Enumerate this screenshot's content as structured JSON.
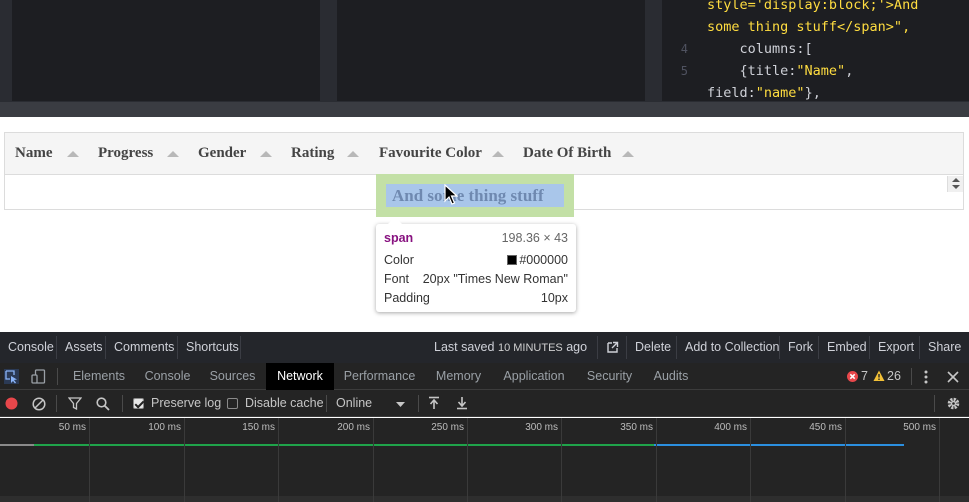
{
  "editor": {
    "lines": [
      {
        "num": "",
        "parts": [
          {
            "t": "style='display:block;'>And",
            "c": "str"
          }
        ]
      },
      {
        "num": "",
        "parts": [
          {
            "t": "some thing stuff</span>\",",
            "c": "str"
          }
        ]
      },
      {
        "num": "4",
        "parts": [
          {
            "t": "    columns:[",
            "c": "key"
          }
        ]
      },
      {
        "num": "5",
        "parts": [
          {
            "t": "    {title:",
            "c": "key"
          },
          {
            "t": "\"Name\"",
            "c": "str"
          },
          {
            "t": ",",
            "c": "key"
          }
        ]
      },
      {
        "num": "",
        "parts": [
          {
            "t": "field:",
            "c": "key"
          },
          {
            "t": "\"name\"",
            "c": "str"
          },
          {
            "t": "},",
            "c": "key"
          }
        ]
      }
    ]
  },
  "table": {
    "columns": [
      "Name",
      "Progress",
      "Gender",
      "Rating",
      "Favourite Color",
      "Date Of Birth"
    ],
    "highlight_text": "And some thing stuff"
  },
  "tooltip": {
    "tag": "span",
    "size": "198.36 × 43",
    "color_label": "Color",
    "color_value": "#000000",
    "font_label": "Font",
    "font_value": "20px \"Times New Roman\"",
    "padding_label": "Padding",
    "padding_value": "10px"
  },
  "codepen_bar": {
    "console": "Console",
    "assets": "Assets",
    "comments": "Comments",
    "shortcuts": "Shortcuts",
    "last_saved_prefix": "Last saved",
    "last_saved_time": "10 MINUTES",
    "last_saved_suffix": "ago",
    "delete": "Delete",
    "add_to_collection": "Add to Collection",
    "fork": "Fork",
    "embed": "Embed",
    "export": "Export",
    "share": "Share"
  },
  "devtools": {
    "tabs": [
      "Elements",
      "Console",
      "Sources",
      "Network",
      "Performance",
      "Memory",
      "Application",
      "Security",
      "Audits"
    ],
    "active_tab": "Network",
    "errors": "7",
    "warnings": "26",
    "preserve_log": "Preserve log",
    "preserve_log_checked": true,
    "disable_cache": "Disable cache",
    "disable_cache_checked": false,
    "throttle": "Online",
    "timeline_labels": [
      "50 ms",
      "100 ms",
      "150 ms",
      "200 ms",
      "250 ms",
      "300 ms",
      "350 ms",
      "400 ms",
      "450 ms",
      "500 ms"
    ],
    "colors": {
      "green": "#1fa34a",
      "blue": "#2b8fe0",
      "error": "#e8474b",
      "warning": "#f2c037",
      "record": "#e8474b"
    }
  }
}
